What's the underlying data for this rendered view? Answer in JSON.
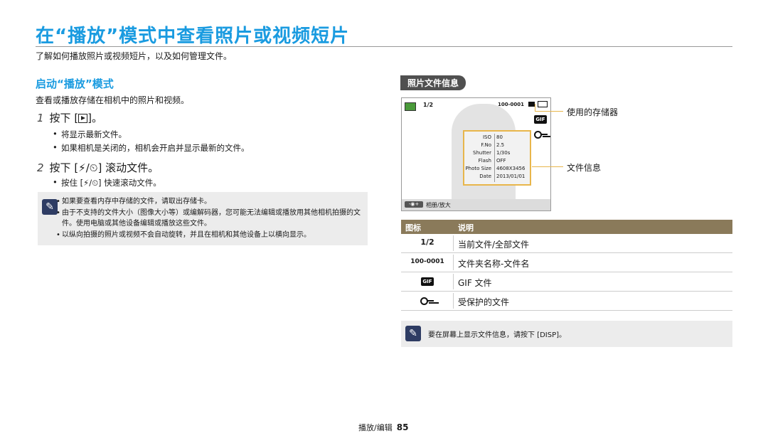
{
  "page": {
    "title": "在“播放”模式中查看照片或视频短片",
    "intro": "了解如何播放照片或视频短片，以及如何管理文件。"
  },
  "section": {
    "heading": "启动“播放”模式",
    "desc": "查看或播放存储在相机中的照片和视频。",
    "step1": {
      "num": "1",
      "text_pre": "按下 [",
      "text_post": "]。"
    },
    "step1_bullets": [
      "将显示最新文件。",
      "如果相机是关闭的，相机会开启并显示最新的文件。"
    ],
    "step2": {
      "num": "2",
      "text": "按下 [⚡/⏲] 滚动文件。"
    },
    "step2_bullets": [
      "按住 [⚡/⏲] 快速滚动文件。"
    ],
    "notes": [
      "如果要查看内存中存储的文件，请取出存储卡。",
      "由于不支持的文件大小（图像大小等）或编解码器，您可能无法编辑或播放用其他相机拍摄的文件。使用电脑或其他设备编辑或播放这些文件。",
      "以纵向拍摄的照片或视频不会自动旋转，并且在相机和其他设备上以横向显示。"
    ]
  },
  "file_info": {
    "badge": "照片文件信息",
    "screen": {
      "counter": "1/2",
      "folder_file": "100-0001",
      "info_labels": [
        "ISO",
        "F.No",
        "Shutter",
        "Flash",
        "Photo Size",
        "Date"
      ],
      "info_values": [
        "80",
        "2.5",
        "1/30s",
        "OFF",
        "4608X3456",
        "2013/01/01"
      ],
      "bottom_label": "相册/放大"
    },
    "callouts": {
      "storage": "使用的存储器",
      "info": "文件信息"
    },
    "table": {
      "headers": [
        "图标",
        "说明"
      ],
      "rows": [
        {
          "icon": "1/2",
          "desc": "当前文件/全部文件"
        },
        {
          "icon": "100-0001",
          "desc": "文件夹名称-文件名"
        },
        {
          "icon": "GIF",
          "desc": "GIF 文件"
        },
        {
          "icon": "key",
          "desc": "受保护的文件"
        }
      ]
    },
    "note": "要在屏幕上显示文件信息，请按下 [DISP]。"
  },
  "footer": {
    "section": "播放/编辑",
    "page_number": "85"
  },
  "colors": {
    "accent": "#1a9be0",
    "callout": "#e8b64b",
    "table_header": "#8a7a5a"
  }
}
